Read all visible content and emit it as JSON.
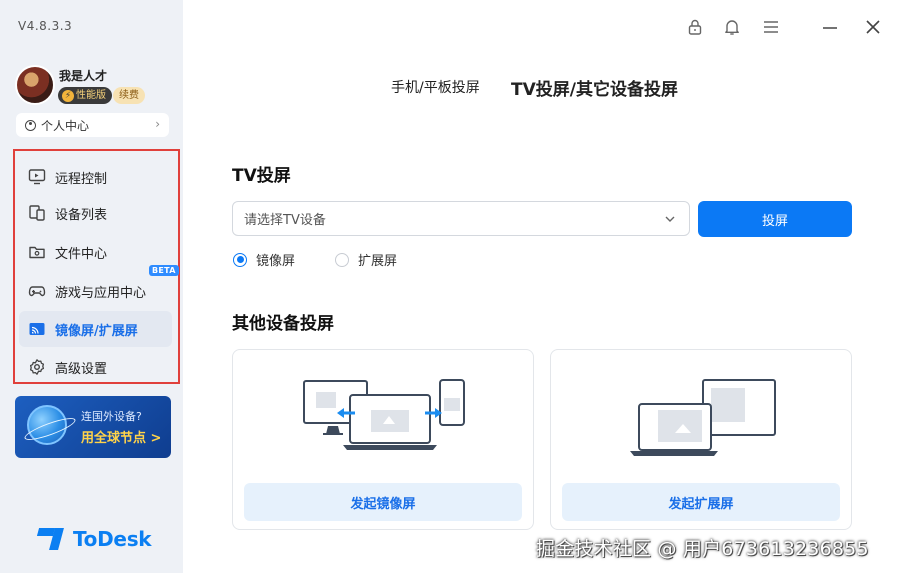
{
  "app": {
    "version": "V4.8.3.3",
    "logo_text": "ToDesk"
  },
  "user": {
    "name": "我是人才",
    "tier_badge": "性能版",
    "renew_badge": "续费",
    "profile_link": "个人中心"
  },
  "sidebar": {
    "items": [
      {
        "label": "远程控制",
        "icon": "monitor-remote-icon",
        "active": false
      },
      {
        "label": "设备列表",
        "icon": "devices-icon",
        "active": false
      },
      {
        "label": "文件中心",
        "icon": "folder-icon",
        "active": false
      },
      {
        "label": "游戏与应用中心",
        "icon": "gamepad-icon",
        "active": false
      },
      {
        "label": "镜像屏/扩展屏",
        "icon": "cast-icon",
        "active": true
      },
      {
        "label": "高级设置",
        "icon": "gear-icon",
        "active": false
      }
    ],
    "beta_badge": "BETA"
  },
  "promo": {
    "line1": "连国外设备?",
    "line2": "用全球节点 >"
  },
  "titlebar": {
    "icons": [
      "lock-icon",
      "bell-icon",
      "menu-icon",
      "minimize-icon",
      "close-icon"
    ]
  },
  "tabs": [
    {
      "label": "手机/平板投屏",
      "active": false
    },
    {
      "label": "TV投屏/其它设备投屏",
      "active": true
    }
  ],
  "tv": {
    "heading": "TV投屏",
    "select_placeholder": "请选择TV设备",
    "cast_button": "投屏",
    "mode_options": [
      {
        "label": "镜像屏",
        "selected": true
      },
      {
        "label": "扩展屏",
        "selected": false
      }
    ]
  },
  "other": {
    "heading": "其他设备投屏",
    "cards": [
      {
        "button": "发起镜像屏",
        "illustration": "mirror-screen-illustration"
      },
      {
        "button": "发起扩展屏",
        "illustration": "extend-screen-illustration"
      }
    ]
  },
  "watermark": "掘金技术社区 @ 用户673613236855",
  "colors": {
    "accent": "#0b79f5",
    "sidebar_bg": "#eef1f6",
    "highlight_border": "#e0403b",
    "card_button_bg": "#e6f1fc"
  }
}
